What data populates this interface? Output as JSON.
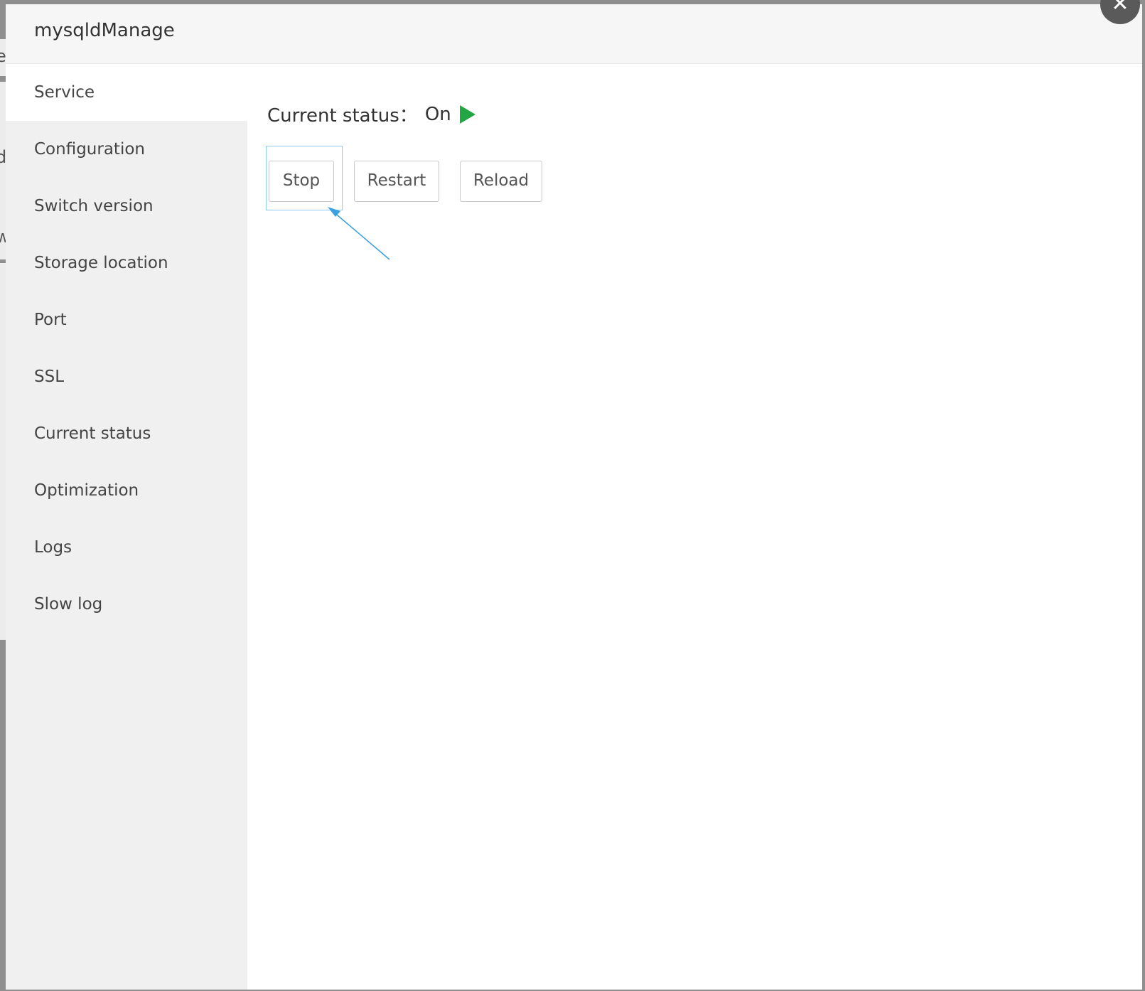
{
  "dialog": {
    "title": "mysqldManage",
    "close_label": "✕"
  },
  "sidebar": {
    "items": [
      {
        "label": "Service",
        "active": true
      },
      {
        "label": "Configuration",
        "active": false
      },
      {
        "label": "Switch version",
        "active": false
      },
      {
        "label": "Storage location",
        "active": false
      },
      {
        "label": "Port",
        "active": false
      },
      {
        "label": "SSL",
        "active": false
      },
      {
        "label": "Current status",
        "active": false
      },
      {
        "label": "Optimization",
        "active": false
      },
      {
        "label": "Logs",
        "active": false
      },
      {
        "label": "Slow log",
        "active": false
      }
    ]
  },
  "service": {
    "status_label": "Current status：",
    "status_value": "On",
    "status_icon": "play-icon",
    "status_color": "#22a744",
    "buttons": {
      "stop": "Stop",
      "restart": "Restart",
      "reload": "Reload"
    }
  },
  "background": {
    "fragments": [
      "e",
      "d",
      "w"
    ]
  }
}
